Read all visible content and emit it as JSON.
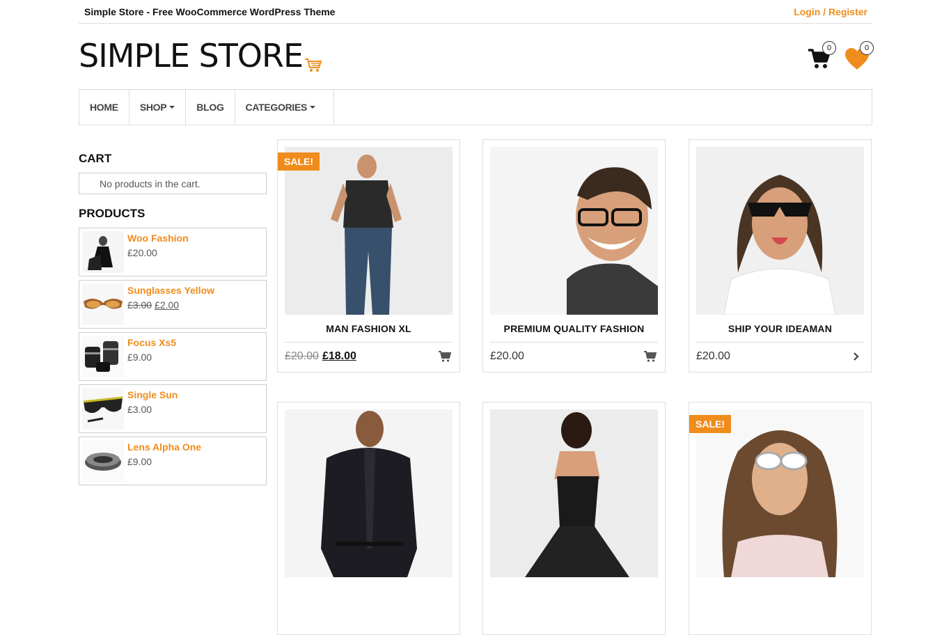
{
  "topbar": {
    "tagline": "Simple Store - Free WooCommerce WordPress Theme",
    "login_label": "Login / Register"
  },
  "header": {
    "logo_text": "SIMPLE STORE",
    "cart_count": "0",
    "wishlist_count": "0"
  },
  "nav": [
    {
      "label": "HOME",
      "dropdown": false
    },
    {
      "label": "SHOP",
      "dropdown": true
    },
    {
      "label": "BLOG",
      "dropdown": false
    },
    {
      "label": "CATEGORIES",
      "dropdown": true
    }
  ],
  "sidebar": {
    "cart_title": "CART",
    "cart_empty": "No products in the cart.",
    "products_title": "PRODUCTS",
    "products": [
      {
        "name": "Woo Fashion",
        "price": "£20.00",
        "old_price": ""
      },
      {
        "name": "Sunglasses Yellow",
        "price": "£2.00",
        "old_price": "£3.00"
      },
      {
        "name": "Focus Xs5",
        "price": "£9.00",
        "old_price": ""
      },
      {
        "name": "Single Sun",
        "price": "£3.00",
        "old_price": ""
      },
      {
        "name": "Lens Alpha One",
        "price": "£9.00",
        "old_price": ""
      }
    ]
  },
  "grid": {
    "sale_label": "SALE!",
    "products": [
      {
        "title": "MAN FASHION XL",
        "price": "£18.00",
        "old_price": "£20.00",
        "sale": true,
        "action_icon": "cart-icon"
      },
      {
        "title": "PREMIUM QUALITY FASHION",
        "price": "£20.00",
        "old_price": "",
        "sale": false,
        "action_icon": "cart-icon"
      },
      {
        "title": "SHIP YOUR IDEAMAN",
        "price": "£20.00",
        "old_price": "",
        "sale": false,
        "action_icon": "chevron-right-icon"
      },
      {
        "title": "",
        "price": "",
        "old_price": "",
        "sale": false
      },
      {
        "title": "",
        "price": "",
        "old_price": "",
        "sale": false
      },
      {
        "title": "",
        "price": "",
        "old_price": "",
        "sale": true
      }
    ]
  },
  "colors": {
    "accent": "#f08c1c",
    "border": "#dddddd",
    "text": "#333333"
  }
}
